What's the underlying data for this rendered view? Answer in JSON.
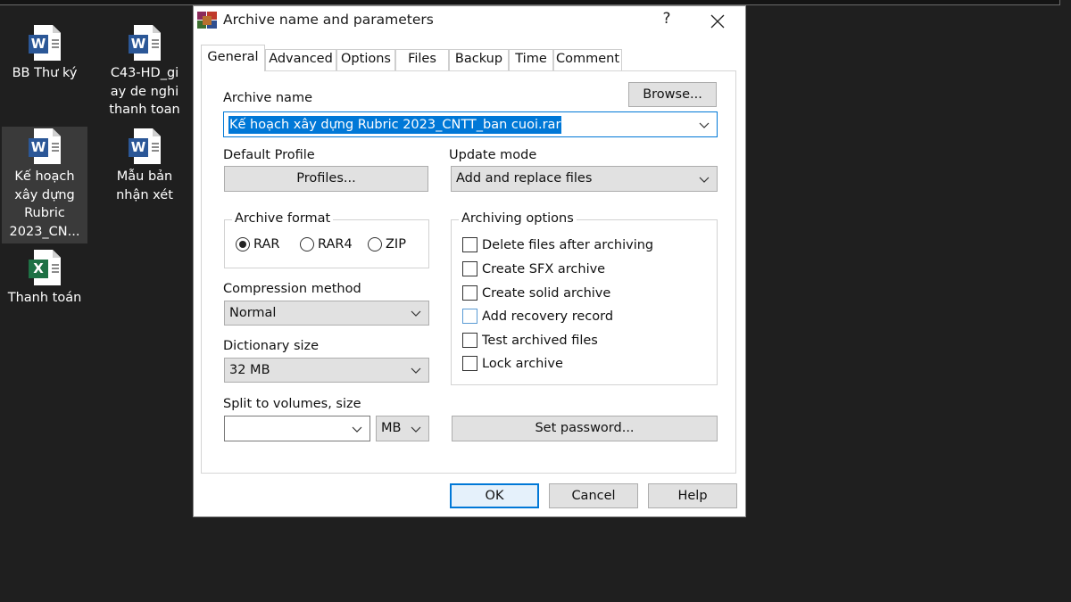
{
  "desktop": {
    "icons": [
      {
        "label": "BB Thư ký",
        "type": "word",
        "badge": "W"
      },
      {
        "label": "C43-HD_gi ay de nghi thanh toan",
        "type": "word",
        "badge": "W"
      },
      {
        "label": "Kế hoạch xây dựng Rubric 2023_CN...",
        "type": "word",
        "badge": "W",
        "selected": true
      },
      {
        "label": "Mẫu bản nhận xét",
        "type": "word",
        "badge": "W"
      },
      {
        "label": "Thanh toán",
        "type": "excel",
        "badge": "X"
      }
    ]
  },
  "dialog": {
    "title": "Archive name and parameters",
    "icon": "winrar-icon",
    "help_label": "?",
    "tabs": [
      {
        "label": "General",
        "active": true
      },
      {
        "label": "Advanced"
      },
      {
        "label": "Options"
      },
      {
        "label": "Files"
      },
      {
        "label": "Backup"
      },
      {
        "label": "Time"
      },
      {
        "label": "Comment"
      }
    ],
    "general": {
      "archive_name_label": "Archive name",
      "browse_label": "Browse...",
      "archive_name_value": "Kế hoạch xây dựng Rubric 2023_CNTT_ban cuoi.rar",
      "default_profile_label": "Default Profile",
      "profiles_label": "Profiles...",
      "update_mode_label": "Update mode",
      "update_mode_value": "Add and replace files",
      "archive_format": {
        "title": "Archive format",
        "options": [
          {
            "label": "RAR",
            "selected": true
          },
          {
            "label": "RAR4",
            "selected": false
          },
          {
            "label": "ZIP",
            "selected": false
          }
        ]
      },
      "compression_method_label": "Compression method",
      "compression_method_value": "Normal",
      "dictionary_size_label": "Dictionary size",
      "dictionary_size_value": "32 MB",
      "split_label": "Split to volumes, size",
      "split_value": "",
      "split_unit": "MB",
      "archiving_options": {
        "title": "Archiving options",
        "items": [
          {
            "label": "Delete files after archiving",
            "checked": false
          },
          {
            "label": "Create SFX archive",
            "checked": false
          },
          {
            "label": "Create solid archive",
            "checked": false
          },
          {
            "label": "Add recovery record",
            "checked": false
          },
          {
            "label": "Test archived files",
            "checked": false
          },
          {
            "label": "Lock archive",
            "checked": false
          }
        ]
      },
      "set_password_label": "Set password..."
    },
    "buttons": {
      "ok": "OK",
      "cancel": "Cancel",
      "help": "Help"
    }
  }
}
